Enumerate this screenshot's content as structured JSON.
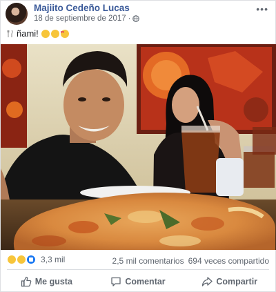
{
  "post": {
    "author": "Majiito Cedeño Lucas",
    "date": "18 de septiembre de 2017",
    "separator": "·",
    "privacy_icon": "globe-icon",
    "more_icon": "more-options-icon",
    "more_label": "•••",
    "caption_prefix_icon": "fork-knife-icon",
    "caption_text": "ñami!",
    "caption_emojis": [
      "grinning-face-icon",
      "grinning-face-icon",
      "heart-eyes-face-icon"
    ],
    "photo_description_icon": "photo"
  },
  "engagement": {
    "reaction_icons": [
      "sad-reaction-icon",
      "haha-reaction-icon",
      "like-reaction-icon"
    ],
    "reaction_count": "3,3 mil",
    "comments": "2,5 mil comentarios",
    "shares": "694 veces compartido"
  },
  "actions": {
    "like": "Me gusta",
    "comment": "Comentar",
    "share": "Compartir"
  },
  "colors": {
    "author_link": "#385898",
    "muted_text": "#606770",
    "like_blue": "#1877f2",
    "divider": "#dadde1"
  }
}
